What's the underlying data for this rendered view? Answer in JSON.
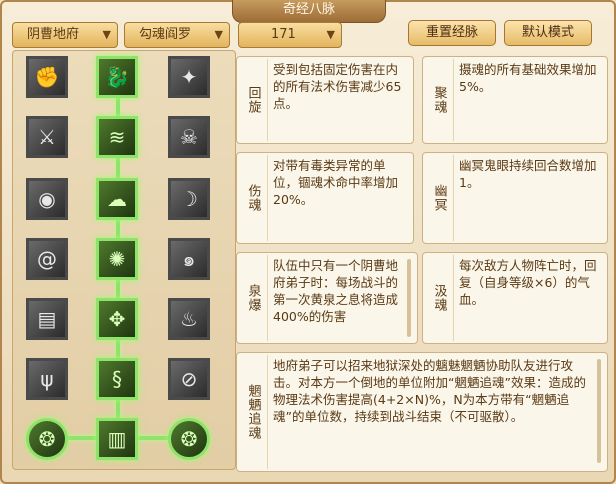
{
  "window": {
    "title": "奇经八脉"
  },
  "filters": {
    "sect": "阴曹地府",
    "school": "勾魂阎罗",
    "level": "171"
  },
  "buttons": {
    "reset": "重置经脉",
    "default": "默认模式"
  },
  "skills": [
    {
      "name": "回旋",
      "desc": "受到包括固定伤害在内的所有法术伤害减少65点。"
    },
    {
      "name": "聚魂",
      "desc": "摄魂的所有基础效果增加5%。"
    },
    {
      "name": "伤魂",
      "desc": "对带有毒类异常的单位，锢魂术命中率增加20%。"
    },
    {
      "name": "幽冥",
      "desc": "幽冥鬼眼持续回合数增加1。"
    },
    {
      "name": "泉爆",
      "desc": "队伍中只有一个阴曹地府弟子时：每场战斗的第一次黄泉之息将造成400%的伤害"
    },
    {
      "name": "汲魂",
      "desc": "每次敌方人物阵亡时，回复（自身等级×6）的气血。"
    },
    {
      "name": "魍魉追魂",
      "desc": "地府弟子可以招来地狱深处的魑魅魍魉协助队友进行攻击。对本方一个倒地的单位附加“魍魉追魂”效果：造成的物理法术伤害提高(4+2×N)%，N为本方带有“魍魉追魂”的单位数，持续到战斗结束（不可驱散）。"
    }
  ],
  "tree": {
    "icons": [
      [
        "fist-icon",
        "dragon-icon",
        "kick-icon"
      ],
      [
        "dagger-icon",
        "wave-icon",
        "skull-icon"
      ],
      [
        "eye-icon",
        "cloud-icon",
        "ghost-icon"
      ],
      [
        "spiral-icon",
        "fire-icon",
        "swirl-icon"
      ],
      [
        "scroll-icon",
        "knot-icon",
        "flame-icon"
      ],
      [
        "claw-icon",
        "serpent-icon",
        "blade-icon"
      ],
      [
        "vortex-icon",
        "book-icon",
        "vortex-icon"
      ]
    ]
  },
  "colors": {
    "active": "#8fe36a",
    "frame": "#b0864c",
    "text": "#5a3a14"
  }
}
